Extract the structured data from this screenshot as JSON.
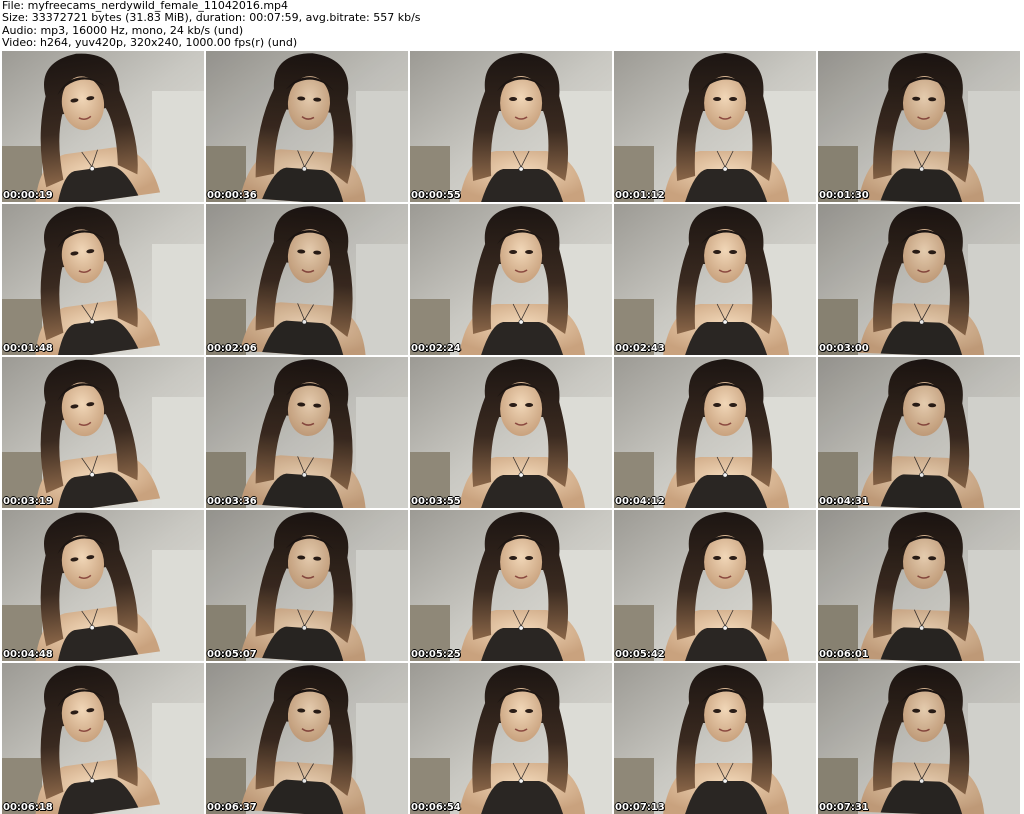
{
  "header": {
    "file": "File: myfreecams_nerdywild_female_11042016.mp4",
    "size": "Size: 33372721 bytes (31.83 MiB), duration: 00:07:59, avg.bitrate: 557 kb/s",
    "audio": "Audio: mp3, 16000 Hz, mono, 24 kb/s (und)",
    "video": "Video: h264, yuv420p, 320x240, 1000.00 fps(r) (und)"
  },
  "thumbnails": [
    {
      "time": "00:00:19"
    },
    {
      "time": "00:00:36"
    },
    {
      "time": "00:00:55"
    },
    {
      "time": "00:01:12"
    },
    {
      "time": "00:01:30"
    },
    {
      "time": "00:01:48"
    },
    {
      "time": "00:02:06"
    },
    {
      "time": "00:02:24"
    },
    {
      "time": "00:02:43"
    },
    {
      "time": "00:03:00"
    },
    {
      "time": "00:03:19"
    },
    {
      "time": "00:03:36"
    },
    {
      "time": "00:03:55"
    },
    {
      "time": "00:04:12"
    },
    {
      "time": "00:04:31"
    },
    {
      "time": "00:04:48"
    },
    {
      "time": "00:05:07"
    },
    {
      "time": "00:05:25"
    },
    {
      "time": "00:05:42"
    },
    {
      "time": "00:06:01"
    },
    {
      "time": "00:06:18"
    },
    {
      "time": "00:06:37"
    },
    {
      "time": "00:06:54"
    },
    {
      "time": "00:07:13"
    },
    {
      "time": "00:07:31"
    }
  ]
}
